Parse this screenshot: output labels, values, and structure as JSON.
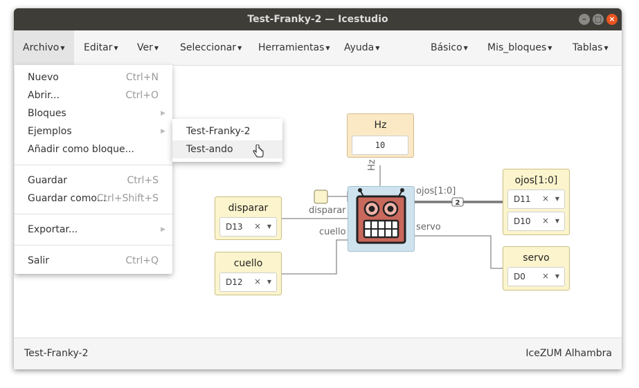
{
  "window": {
    "title": "Test-Franky-2 — Icestudio",
    "buttons": {
      "minimize": "–",
      "maximize": "□",
      "close": "×"
    }
  },
  "menubar": {
    "archivo": "Archivo",
    "editar": "Editar",
    "ver": "Ver",
    "seleccionar": "Seleccionar",
    "herramientas": "Herramientas",
    "ayuda": "Ayuda",
    "basico": "Básico",
    "mis_bloques": "Mis_bloques",
    "tablas": "Tablas"
  },
  "archivo_menu": {
    "nuevo": {
      "label": "Nuevo",
      "shortcut": "Ctrl+N"
    },
    "abrir": {
      "label": "Abrir...",
      "shortcut": "Ctrl+O"
    },
    "bloques": {
      "label": "Bloques"
    },
    "ejemplos": {
      "label": "Ejemplos"
    },
    "anadir": {
      "label": "Añadir como bloque..."
    },
    "guardar": {
      "label": "Guardar",
      "shortcut": "Ctrl+S"
    },
    "guardar_como": {
      "label": "Guardar como...",
      "shortcut": "Ctrl+Shift+S"
    },
    "exportar": {
      "label": "Exportar..."
    },
    "salir": {
      "label": "Salir",
      "shortcut": "Ctrl+Q"
    }
  },
  "submenu": {
    "item1": "Test-Franky-2",
    "item2": "Test-ando"
  },
  "blocks": {
    "hz": {
      "title": "Hz",
      "value": "10"
    },
    "disparar": {
      "title": "disparar",
      "value": "D13"
    },
    "cuello": {
      "title": "cuello",
      "value": "D12"
    },
    "ojos": {
      "title": "ojos[1:0]",
      "values": [
        "D11",
        "D10"
      ]
    },
    "servo": {
      "title": "servo",
      "value": "D0"
    }
  },
  "wires": {
    "hz_label": "Hz",
    "disparar_label": "disparar",
    "cuello_label": "cuello",
    "ojos_label": "ojos[1:0]",
    "servo_label": "servo",
    "bus_width": "2"
  },
  "status": {
    "project": "Test-Franky-2",
    "board": "IceZUM Alhambra"
  },
  "colors": {
    "titlebar": "#3f3d38",
    "close_button": "#e95420",
    "input_block": "#fbf4cc",
    "robot_block": "#cfe3ee",
    "robot_face": "#c9685c"
  },
  "icons": {
    "clear": "×",
    "dropdown": "▼",
    "submenu_arrow": "▶",
    "menu_caret": "▾"
  }
}
